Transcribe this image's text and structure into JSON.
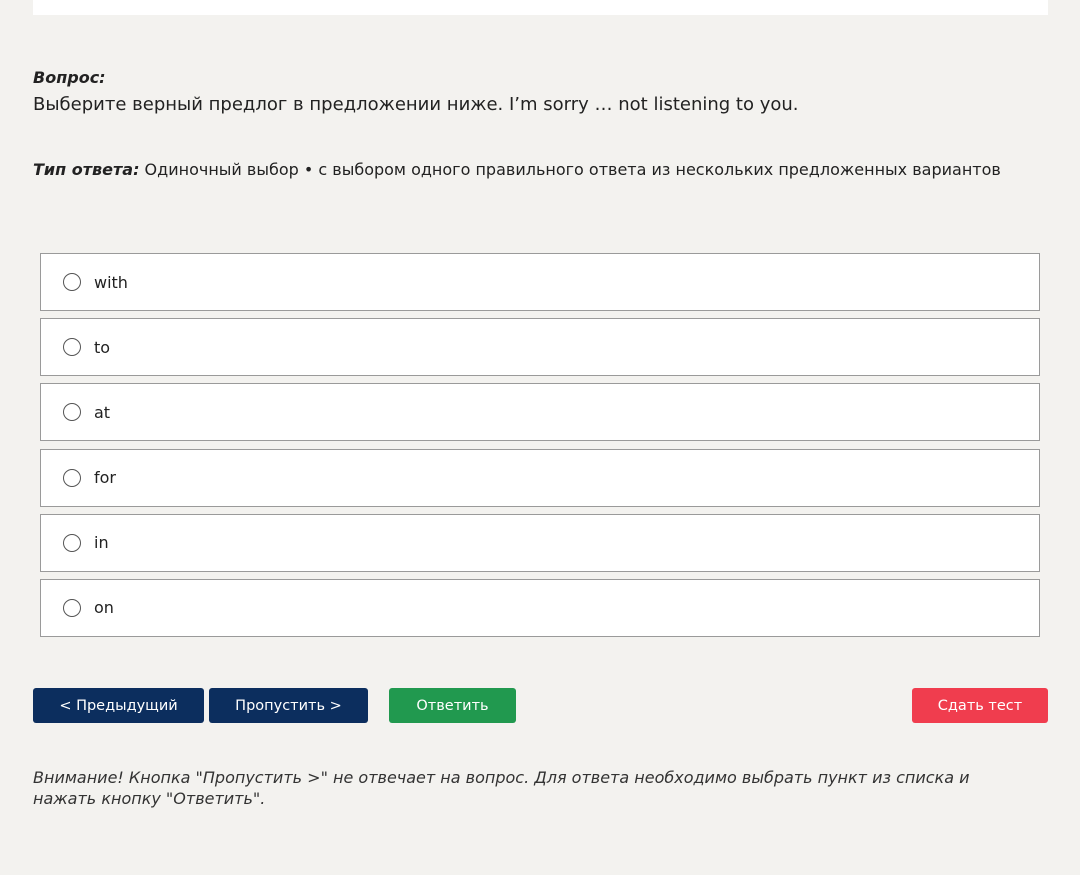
{
  "question": {
    "label": "Вопрос:",
    "text": "Выберите верный предлог в предложении ниже. I’m sorry … not listening to you."
  },
  "answer_type": {
    "label": "Тип ответа:",
    "value": " Одиночный выбор • с выбором одного правильного ответа из нескольких предложенных вариантов"
  },
  "options": [
    {
      "label": "with"
    },
    {
      "label": "to"
    },
    {
      "label": "at"
    },
    {
      "label": "for"
    },
    {
      "label": "in"
    },
    {
      "label": "on"
    }
  ],
  "buttons": {
    "prev": "< Предыдущий",
    "skip": "Пропустить >",
    "answer": "Ответить",
    "submit": "Сдать тест"
  },
  "notice": "Внимание! Кнопка \"Пропустить >\" не отвечает на вопрос. Для ответа необходимо выбрать пункт из списка и нажать кнопку \"Ответить\".",
  "colors": {
    "background": "#f3f2ef",
    "primary_button": "#0c2e5e",
    "answer_button": "#21994f",
    "submit_button": "#f03d4e"
  }
}
